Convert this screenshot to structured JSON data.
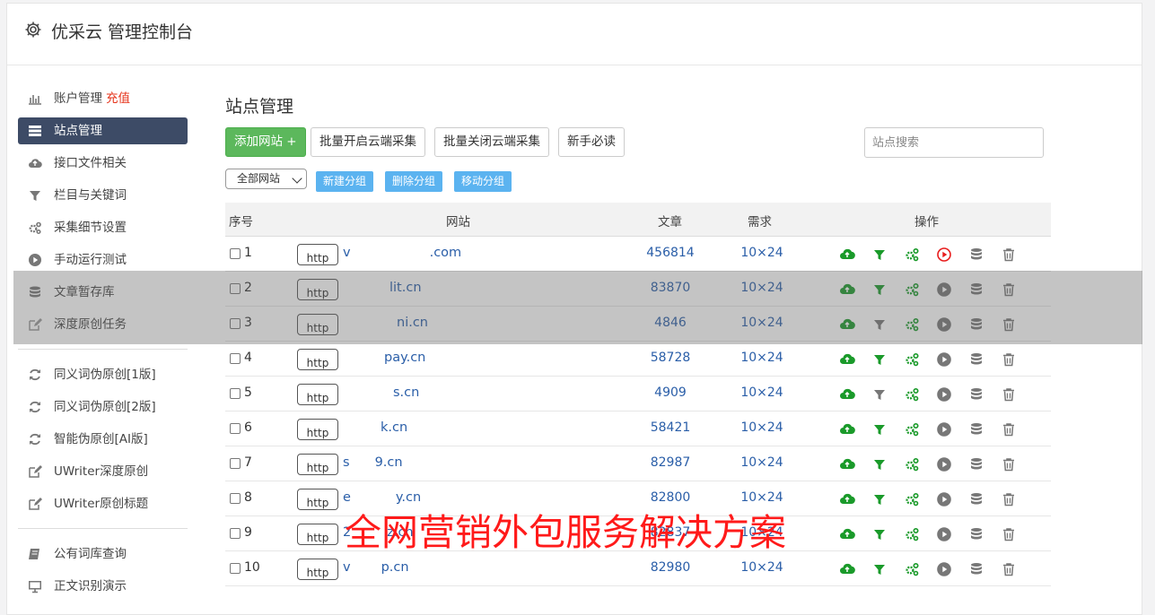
{
  "header": {
    "title": "优采云 管理控制台",
    "icon": "gear-icon"
  },
  "sidebar": {
    "group1": [
      {
        "label": "账户管理",
        "extra": "充值",
        "icon": "bar-chart-icon"
      },
      {
        "label": "站点管理",
        "icon": "server-list-icon",
        "active": true
      },
      {
        "label": "接口文件相关",
        "icon": "cloud-upload-icon"
      },
      {
        "label": "栏目与关键词",
        "icon": "filter-icon"
      },
      {
        "label": "采集细节设置",
        "icon": "cogs-icon"
      },
      {
        "label": "手动运行测试",
        "icon": "play-circle-icon"
      },
      {
        "label": "文章暂存库",
        "icon": "database-icon"
      },
      {
        "label": "深度原创任务",
        "icon": "edit-icon"
      }
    ],
    "group2": [
      {
        "label": "同义词伪原创[1版]",
        "icon": "refresh-icon"
      },
      {
        "label": "同义词伪原创[2版]",
        "icon": "refresh-icon"
      },
      {
        "label": "智能伪原创[AI版]",
        "icon": "refresh-icon"
      },
      {
        "label": "UWriter深度原创",
        "icon": "edit-icon"
      },
      {
        "label": "UWriter原创标题",
        "icon": "edit-icon"
      }
    ],
    "group3": [
      {
        "label": "公有词库查询",
        "icon": "book-icon"
      },
      {
        "label": "正文识别演示",
        "icon": "monitor-icon"
      }
    ]
  },
  "main": {
    "title": "站点管理",
    "toolbar": {
      "add_site": "添加网站 +",
      "batch_open": "批量开启云端采集",
      "batch_close": "批量关闭云端采集",
      "newbie": "新手必读",
      "search_placeholder": "站点搜索"
    },
    "group_select": "全部网站",
    "group_buttons": {
      "new": "新建分组",
      "delete": "删除分组",
      "move": "移动分组"
    },
    "table": {
      "headers": {
        "index": "序号",
        "site": "网站",
        "articles": "文章",
        "demand": "需求",
        "ops": "操作"
      },
      "protocol_label": "http",
      "rows": [
        {
          "index": "1",
          "site": "v",
          "site_end": ".com",
          "articles": "456814",
          "demand": "10×24",
          "filter_active": true,
          "play_active": true
        },
        {
          "index": "2",
          "site": "",
          "site_end": "lit.cn",
          "articles": "83870",
          "demand": "10×24",
          "filter_active": true,
          "play_active": false
        },
        {
          "index": "3",
          "site": "",
          "site_end": "ni.cn",
          "articles": "4846",
          "demand": "10×24",
          "filter_active": false,
          "play_active": false
        },
        {
          "index": "4",
          "site": "",
          "site_end": "pay.cn",
          "articles": "58728",
          "demand": "10×24",
          "filter_active": true,
          "play_active": false
        },
        {
          "index": "5",
          "site": "",
          "site_end": "s.cn",
          "articles": "4909",
          "demand": "10×24",
          "filter_active": false,
          "play_active": false
        },
        {
          "index": "6",
          "site": "",
          "site_end": "k.cn",
          "articles": "58421",
          "demand": "10×24",
          "filter_active": true,
          "play_active": false
        },
        {
          "index": "7",
          "site": "s",
          "site_end": "9.cn",
          "articles": "82987",
          "demand": "10×24",
          "filter_active": true,
          "play_active": false
        },
        {
          "index": "8",
          "site": "e",
          "site_end": "y.cn",
          "articles": "82800",
          "demand": "10×24",
          "filter_active": true,
          "play_active": false
        },
        {
          "index": "9",
          "site": "2",
          "site_end": "z.cn",
          "articles": "82837",
          "demand": "10×24",
          "filter_active": true,
          "play_active": false
        },
        {
          "index": "10",
          "site": "v",
          "site_end": "p.cn",
          "articles": "82980",
          "demand": "10×24",
          "filter_active": true,
          "play_active": false
        }
      ]
    }
  },
  "watermark": "全网营销外包服务解决方案",
  "colors": {
    "green": "#1a9a2a",
    "gray_icon": "#777777",
    "red_play": "#e81c1c",
    "link_blue": "#2a5ea8",
    "active_nav": "#3d4b66"
  }
}
